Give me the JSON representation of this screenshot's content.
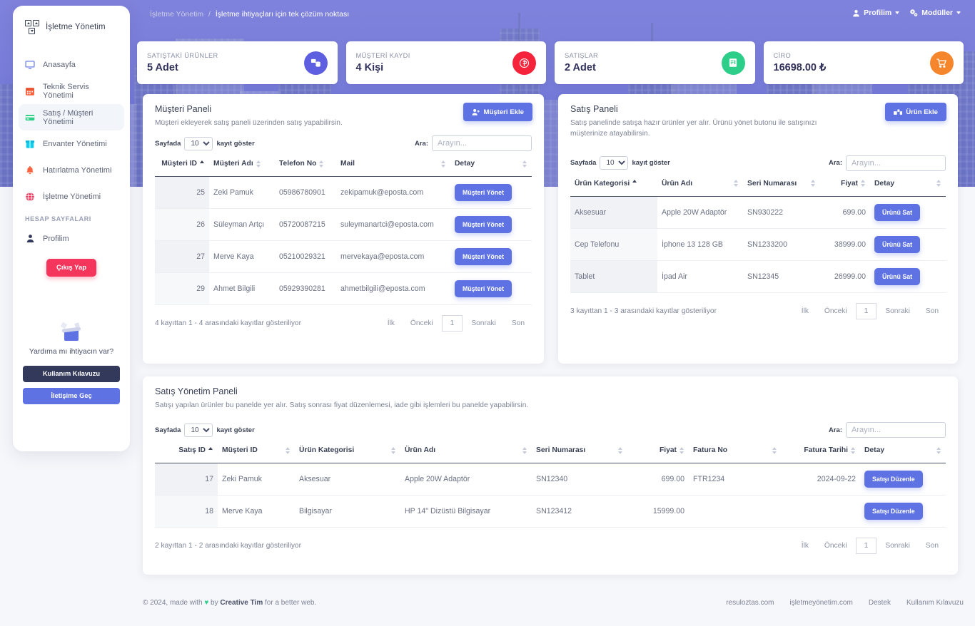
{
  "brand": {
    "name": "İşletme Yönetim",
    "logo_icon": "blocks-logo-icon"
  },
  "sidebar": {
    "items": [
      {
        "label": "Anasayfa",
        "icon": "monitor-icon",
        "active": false
      },
      {
        "label": "Teknik Servis Yönetimi",
        "icon": "calendar-icon",
        "active": false
      },
      {
        "label": "Satış / Müşteri Yönetimi",
        "icon": "credit-card-icon",
        "active": true
      },
      {
        "label": "Envanter Yönetimi",
        "icon": "box-icon",
        "active": false
      },
      {
        "label": "Hatırlatma Yönetimi",
        "icon": "bell-icon",
        "active": false
      },
      {
        "label": "İşletme Yönetimi",
        "icon": "globe-icon",
        "active": false
      }
    ],
    "section_label": "HESAP SAYFALARI",
    "profile_label": "Profilim",
    "profile_icon": "user-icon",
    "logout_label": "Çıkış Yap",
    "help": {
      "title": "Yardıma mı ihtiyacın var?",
      "image_icon": "gift-box-icon",
      "manual_label": "Kullanım Kılavuzu",
      "contact_label": "İletişime Geç"
    }
  },
  "breadcrumb": {
    "root": "İşletme Yönetim",
    "separator": "/",
    "current": "İşletme ihtiyaçları için tek çözüm noktası"
  },
  "topnav": {
    "profile_label": "Profilim",
    "profile_icon": "user-icon",
    "modules_label": "Modüller",
    "modules_icon": "gears-icon"
  },
  "stats": [
    {
      "label": "SATIŞTAKİ ÜRÜNLER",
      "value": "5 Adet",
      "icon": "products-icon",
      "color": "#5e5fe0"
    },
    {
      "label": "MÜŞTERİ KAYDI",
      "value": "4 Kişi",
      "icon": "coin-icon",
      "color": "#f5243b"
    },
    {
      "label": "SATIŞLAR",
      "value": "2 Adet",
      "icon": "receipt-icon",
      "color": "#2dce89"
    },
    {
      "label": "CİRO",
      "value": "16698.00 ₺",
      "icon": "cart-icon",
      "color": "#f5862b"
    }
  ],
  "customers_panel": {
    "title": "Müşteri Paneli",
    "description": "Müşteri ekleyerek satış paneli üzerinden satış yapabilirsin.",
    "add_button": "Müşteri Ekle",
    "add_button_icon": "user-plus-icon",
    "length_prefix": "Sayfada",
    "length_value": "10",
    "length_suffix": "kayıt göster",
    "search_label": "Ara:",
    "search_placeholder": "Arayın...",
    "search_value": "",
    "columns": [
      "Müşteri ID",
      "Müşteri Adı",
      "Telefon No",
      "Mail",
      "Detay"
    ],
    "rows": [
      {
        "id": "25",
        "name": "Zeki Pamuk",
        "phone": "05986780901",
        "mail": "zekipamuk@eposta.com",
        "action": "Müşteri Yönet"
      },
      {
        "id": "26",
        "name": "Süleyman Artçı",
        "phone": "05720087215",
        "mail": "suleymanartci@eposta.com",
        "action": "Müşteri Yönet"
      },
      {
        "id": "27",
        "name": "Merve Kaya",
        "phone": "05210029321",
        "mail": "mervekaya@eposta.com",
        "action": "Müşteri Yönet"
      },
      {
        "id": "29",
        "name": "Ahmet Bilgili",
        "phone": "05929390281",
        "mail": "ahmetbilgili@eposta.com",
        "action": "Müşteri Yönet"
      }
    ],
    "info": "4 kayıttan 1 - 4 arasındaki kayıtlar gösteriliyor",
    "pager": {
      "first": "İlk",
      "prev": "Önceki",
      "page": "1",
      "next": "Sonraki",
      "last": "Son"
    }
  },
  "products_panel": {
    "title": "Satış Paneli",
    "description": "Satış panelinde satışa hazır ürünler yer alır. Ürünü yönet butonu ile satışınızı müşterinize atayabilirsin.",
    "add_button": "Ürün Ekle",
    "add_button_icon": "boxes-icon",
    "length_prefix": "Sayfada",
    "length_value": "10",
    "length_suffix": "kayıt göster",
    "search_label": "Ara:",
    "search_placeholder": "Arayın...",
    "search_value": "",
    "columns": [
      "Ürün Kategorisi",
      "Ürün Adı",
      "Seri Numarası",
      "Fiyat",
      "Detay"
    ],
    "rows": [
      {
        "category": "Aksesuar",
        "name": "Apple 20W Adaptör",
        "serial": "SN930222",
        "price": "699.00",
        "action": "Ürünü Sat"
      },
      {
        "category": "Cep Telefonu",
        "name": "İphone 13 128 GB",
        "serial": "SN1233200",
        "price": "38999.00",
        "action": "Ürünü Sat"
      },
      {
        "category": "Tablet",
        "name": "İpad Air",
        "serial": "SN12345",
        "price": "26999.00",
        "action": "Ürünü Sat"
      }
    ],
    "info": "3 kayıttan 1 - 3 arasındaki kayıtlar gösteriliyor",
    "pager": {
      "first": "İlk",
      "prev": "Önceki",
      "page": "1",
      "next": "Sonraki",
      "last": "Son"
    }
  },
  "sales_panel": {
    "title": "Satış Yönetim Paneli",
    "description": "Satışı yapılan ürünler bu panelde yer alır. Satış sonrası fiyat düzenlemesi, iade gibi işlemleri bu panelde yapabilirsin.",
    "length_prefix": "Sayfada",
    "length_value": "10",
    "length_suffix": "kayıt göster",
    "search_label": "Ara:",
    "search_placeholder": "Arayın...",
    "search_value": "",
    "columns": [
      "Satış ID",
      "Müşteri ID",
      "Ürün Kategorisi",
      "Ürün Adı",
      "Seri Numarası",
      "Fiyat",
      "Fatura No",
      "Fatura Tarihi",
      "Detay"
    ],
    "rows": [
      {
        "sale_id": "17",
        "customer": "Zeki Pamuk",
        "category": "Aksesuar",
        "product": "Apple 20W Adaptör",
        "serial": "SN12340",
        "price": "699.00",
        "invoice_no": "FTR1234",
        "invoice_date": "2024-09-22",
        "action": "Satışı Düzenle"
      },
      {
        "sale_id": "18",
        "customer": "Merve Kaya",
        "category": "Bilgisayar",
        "product": "HP 14\" Dizüstü Bilgisayar",
        "serial": "SN123412",
        "price": "15999.00",
        "invoice_no": "",
        "invoice_date": "",
        "action": "Satışı Düzenle"
      }
    ],
    "info": "2 kayıttan 1 - 2 arasındaki kayıtlar gösteriliyor",
    "pager": {
      "first": "İlk",
      "prev": "Önceki",
      "page": "1",
      "next": "Sonraki",
      "last": "Son"
    }
  },
  "footer": {
    "copyright_pre": "© 2024, made with",
    "heart_icon": "heart-icon",
    "copyright_by": "by",
    "brand": "Creative Tim",
    "copyright_post": "for a better web.",
    "links": [
      "resuloztas.com",
      "işletmeyönetim.com",
      "Destek",
      "Kullanım Kılavuzu"
    ]
  }
}
